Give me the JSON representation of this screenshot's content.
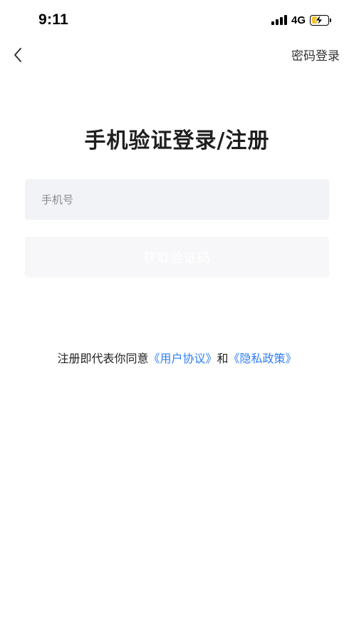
{
  "status_bar": {
    "time": "9:11",
    "network": "4G",
    "battery_level": 0.35,
    "battery_color": "#f4c430",
    "signal_bars": 4,
    "icons": [
      "signal-icon",
      "battery-icon",
      "charging-bolt-icon"
    ]
  },
  "nav": {
    "back_icon": "chevron-left-icon",
    "right_link": "密码登录"
  },
  "title": "手机验证登录/注册",
  "phone_input": {
    "placeholder": "手机号",
    "value": ""
  },
  "get_code_button": {
    "label": "获取验证码",
    "enabled": false
  },
  "agreement": {
    "prefix": "注册即代表你同意",
    "user_agreement": "《用户协议》",
    "conjunction": "和",
    "privacy_policy": "《隐私政策》",
    "link_color": "#2f7ef5"
  }
}
